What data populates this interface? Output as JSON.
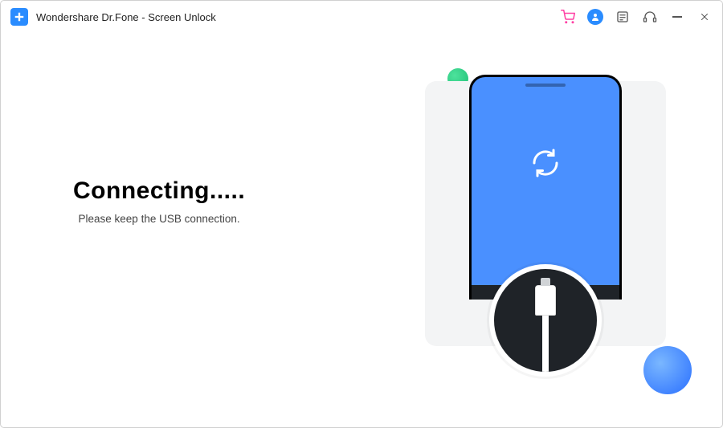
{
  "titlebar": {
    "app_name": "Wondershare Dr.Fone - Screen Unlock"
  },
  "main": {
    "heading": "Connecting.....",
    "subtitle": "Please keep the USB connection."
  }
}
